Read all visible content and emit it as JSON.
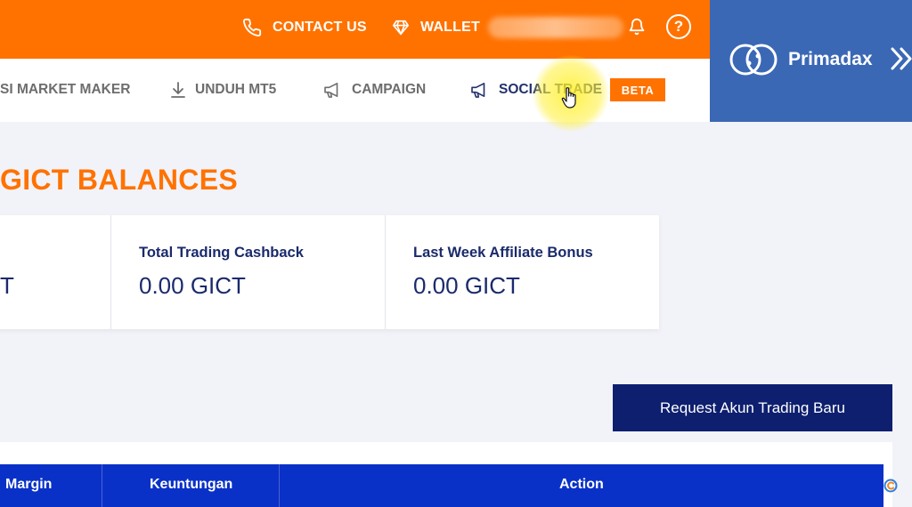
{
  "topbar": {
    "contact_label": "CONTACT US",
    "wallet_label": "WALLET"
  },
  "brand": {
    "name": "Primadax"
  },
  "nav": {
    "items": [
      {
        "label": "SI MARKET MAKER",
        "icon": "market-maker"
      },
      {
        "label": "UNDUH MT5",
        "icon": "download-icon"
      },
      {
        "label": "CAMPAIGN",
        "icon": "megaphone-icon"
      },
      {
        "label": "SOCIAL TRADE",
        "icon": "megaphone-icon"
      }
    ],
    "beta_badge": "BETA"
  },
  "page": {
    "title": "GICT BALANCES"
  },
  "balances": {
    "cut_value": "T",
    "cards": [
      {
        "label": "Total Trading Cashback",
        "value": "0.00 GICT"
      },
      {
        "label": "Last Week Affiliate Bonus",
        "value": "0.00 GICT"
      }
    ]
  },
  "actions": {
    "request_account": "Request Akun Trading Baru"
  },
  "table": {
    "columns": [
      "Margin",
      "Keuntungan",
      "Action"
    ]
  },
  "colors": {
    "orange": "#ff7200",
    "navy": "#0d1f6e",
    "table_header": "#0a31c7",
    "brand_panel": "#3b68b5"
  }
}
